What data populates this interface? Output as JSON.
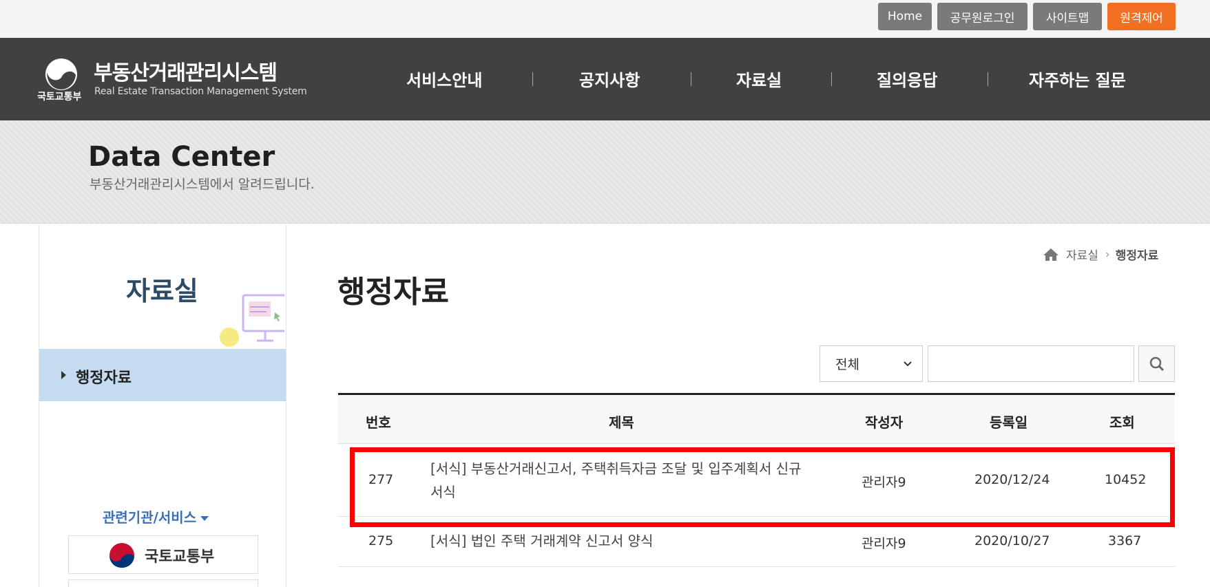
{
  "utility": {
    "home": "Home",
    "login": "공무원로그인",
    "sitemap": "사이트맵",
    "remote": "원격제어"
  },
  "header": {
    "logo_title": "부동산거래관리시스템",
    "logo_subtitle": "Real Estate Transaction Management System",
    "ministry": "국토교통부",
    "nav": [
      "서비스안내",
      "공지사항",
      "자료실",
      "질의응답",
      "자주하는 질문"
    ]
  },
  "visual": {
    "title": "Data Center",
    "description": "부동산거래관리시스템에서 알려드립니다."
  },
  "sidebar": {
    "title": "자료실",
    "items": [
      {
        "label": "행정자료",
        "active": true
      }
    ],
    "related_label": "관련기관/서비스",
    "partners": [
      "국토교통부"
    ]
  },
  "breadcrumb": {
    "parent": "자료실",
    "current": "행정자료"
  },
  "page_title": "행정자료",
  "search": {
    "selected_option": "전체",
    "query": "",
    "placeholder": ""
  },
  "table": {
    "headers": [
      "번호",
      "제목",
      "작성자",
      "등록일",
      "조회"
    ],
    "rows": [
      {
        "no": "277",
        "title": "[서식] 부동산거래신고서, 주택취득자금 조달 및 입주계획서 신규 서식",
        "author": "관리자9",
        "date": "2020/12/24",
        "views": "10452"
      },
      {
        "no": "275",
        "title": "[서식] 법인 주택 거래계약 신고서 양식",
        "author": "관리자9",
        "date": "2020/10/27",
        "views": "3367"
      }
    ]
  },
  "colors": {
    "header_bg": "#414141",
    "accent_orange": "#f36f21",
    "sidebar_active": "#c4dbf0",
    "highlight": "#ff0000"
  }
}
